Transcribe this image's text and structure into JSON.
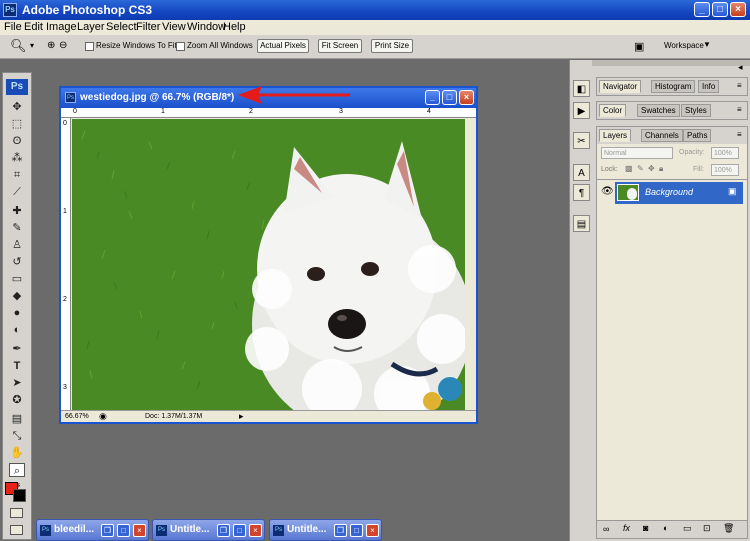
{
  "app": {
    "title": "Adobe Photoshop CS3",
    "icon": "Ps"
  },
  "menu": [
    "File",
    "Edit",
    "Image",
    "Layer",
    "Select",
    "Filter",
    "View",
    "Window",
    "Help"
  ],
  "options": {
    "resize_windows": "Resize Windows To Fit",
    "zoom_all": "Zoom All Windows",
    "actual_pixels": "Actual Pixels",
    "fit_screen": "Fit Screen",
    "print_size": "Print Size",
    "workspace": "Workspace"
  },
  "document": {
    "title": "westiedog.jpg @ 66.7% (RGB/8*)",
    "zoom": "66.67%",
    "doc_size": "Doc: 1.37M/1.37M",
    "ruler_h": [
      "0",
      "1",
      "2",
      "3",
      "4"
    ],
    "ruler_v": [
      "0",
      "1",
      "2",
      "3"
    ]
  },
  "panels": {
    "group1": [
      "Navigator",
      "Histogram",
      "Info"
    ],
    "group2": [
      "Color",
      "Swatches",
      "Styles"
    ],
    "group3": [
      "Layers",
      "Channels",
      "Paths"
    ],
    "blend_mode": "Normal",
    "opacity_label": "Opacity:",
    "opacity_value": "100%",
    "lock_label": "Lock:",
    "fill_label": "Fill:",
    "fill_value": "100%",
    "layer_name": "Background"
  },
  "minimized": [
    "bleedil...",
    "Untitle...",
    "Untitle..."
  ],
  "colors": {
    "foreground": "#e52318",
    "background": "#000000",
    "selection": "#3167c6"
  }
}
